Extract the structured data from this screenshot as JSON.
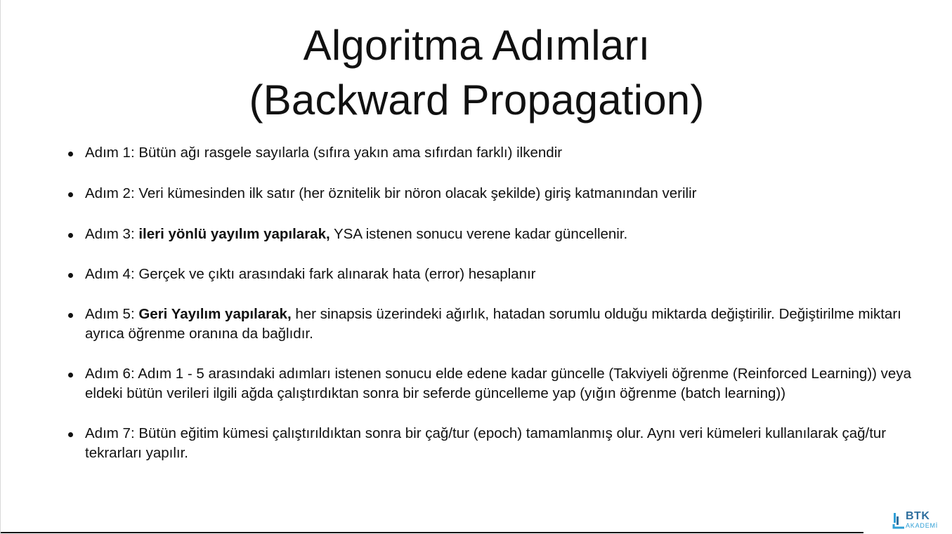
{
  "slide": {
    "title_line1": "Algoritma Adımları",
    "title_line2": "(Backward Propagation)",
    "bullets": [
      {
        "prefix": "Adım 1: ",
        "bold": "",
        "rest": "Bütün ağı rasgele sayılarla (sıfıra yakın ama sıfırdan farklı) ilkendir"
      },
      {
        "prefix": "Adım 2: ",
        "bold": "",
        "rest": "Veri kümesinden ilk satır (her öznitelik bir nöron olacak şekilde) giriş katmanından verilir"
      },
      {
        "prefix": "Adım 3: ",
        "bold": "ileri yönlü yayılım yapılarak,",
        "rest": " YSA istenen sonucu verene kadar güncellenir."
      },
      {
        "prefix": "Adım 4: ",
        "bold": "",
        "rest": "Gerçek ve çıktı arasındaki fark alınarak hata (error) hesaplanır"
      },
      {
        "prefix": "Adım 5: ",
        "bold": "Geri Yayılım yapılarak,",
        "rest": " her sinapsis üzerindeki ağırlık, hatadan sorumlu olduğu miktarda değiştirilir. Değiştirilme miktarı ayrıca öğrenme oranına da bağlıdır."
      },
      {
        "prefix": "Adım 6: ",
        "bold": "",
        "rest": "Adım 1 - 5 arasındaki adımları istenen sonucu elde edene kadar güncelle (Takviyeli öğrenme (Reinforced Learning)) veya eldeki bütün verileri ilgili ağda çalıştırdıktan sonra bir seferde güncelleme yap (yığın öğrenme (batch learning))"
      },
      {
        "prefix": "Adım 7: ",
        "bold": "",
        "rest": "Bütün eğitim kümesi çalıştırıldıktan sonra bir çağ/tur (epoch) tamamlanmış olur. Aynı veri kümeleri kullanılarak çağ/tur tekrarları yapılır."
      }
    ]
  },
  "logo": {
    "name": "BTK",
    "subtitle": "AKADEMİ",
    "icon": "btk-akademi-logo-icon",
    "color_primary": "#2f6f9e",
    "color_secondary": "#2f9fd6"
  }
}
